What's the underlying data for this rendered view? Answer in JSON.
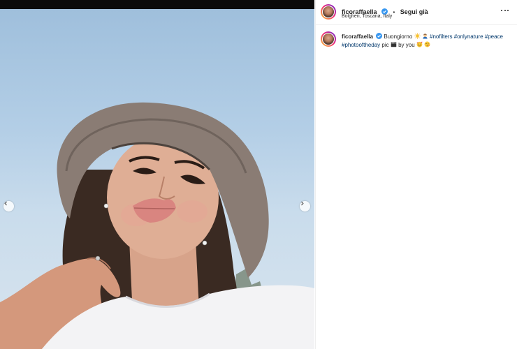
{
  "post": {
    "username": "ficoraffaella",
    "separator": "•",
    "follow_label": "Segui già",
    "location": "Bolgheri, Toscana, Italy"
  },
  "caption": {
    "username": "ficoraffaella",
    "text_1": "Buongiorno",
    "hashtags_1": [
      "#nofilters",
      "#onlynature",
      "#peace"
    ],
    "hashtag_2": "#photooftheday",
    "text_2": "pic",
    "text_3": "by you"
  },
  "icons": {
    "verified": "verified-badge-icon",
    "more": "more-options-icon",
    "prev": "chevron-left-icon",
    "next": "chevron-right-icon"
  },
  "colors": {
    "hashtag": "#00376b",
    "verified": "#3897f0",
    "sky": "#b3cee6"
  }
}
